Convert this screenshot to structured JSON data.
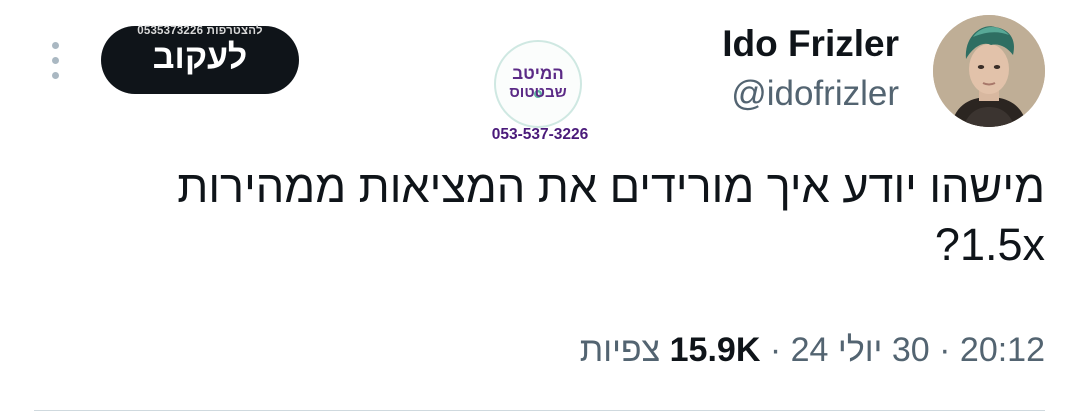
{
  "author": {
    "display_name": "Ido Frizler",
    "handle": "@idofrizler"
  },
  "follow_button": {
    "label": "לעקוב",
    "overlay_text": "0535373226 להצטרפות"
  },
  "watermark_logo": {
    "line1": "המיטב",
    "line2": "שבטטוס",
    "phone": "053-537-3226"
  },
  "tweet": {
    "text": "מישהו יודע איך מורידים את המציאות ממהירות 1.5x?"
  },
  "meta": {
    "time": "20:12",
    "separator": "·",
    "date": "30 יולי 24",
    "views_count": "15.9K",
    "views_label": "צפיות"
  },
  "icons": {
    "more": "more-vertical-icon",
    "avatar": "profile-photo"
  },
  "colors": {
    "text_primary": "#0f1419",
    "text_secondary": "#536471",
    "follow_bg": "#0f1419",
    "divider": "#cfd9de",
    "logo_purple": "#5b2a86"
  }
}
